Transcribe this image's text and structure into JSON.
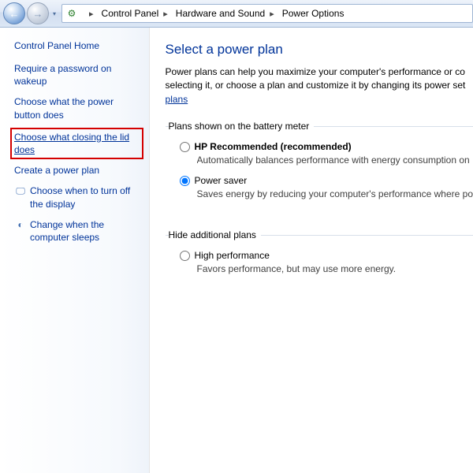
{
  "breadcrumb": {
    "root_chevron": "▸",
    "items": [
      {
        "label": "Control Panel"
      },
      {
        "label": "Hardware and Sound"
      },
      {
        "label": "Power Options"
      }
    ]
  },
  "sidebar": {
    "home": "Control Panel Home",
    "tasks": [
      {
        "label": "Require a password on wakeup",
        "icon": ""
      },
      {
        "label": "Choose what the power button does",
        "icon": ""
      },
      {
        "label": "Choose what closing the lid does",
        "icon": "",
        "highlight": true
      },
      {
        "label": "Create a power plan",
        "icon": ""
      },
      {
        "label": "Choose when to turn off the display",
        "icon": "🖵"
      },
      {
        "label": "Change when the computer sleeps",
        "icon": "◐"
      }
    ]
  },
  "main": {
    "title": "Select a power plan",
    "intro_a": "Power plans can help you maximize your computer's performance or co",
    "intro_b": "selecting it, or choose a plan and customize it by changing its power set",
    "intro_link": "plans",
    "group1_legend": "Plans shown on the battery meter",
    "group2_legend": "Hide additional plans",
    "plans_group1": [
      {
        "id": "plan-hp",
        "name_html": "HP Recommended (recommended)",
        "name_bold": true,
        "desc": "Automatically balances performance with energy consumption on",
        "selected": false
      },
      {
        "id": "plan-powersaver",
        "name_html": "Power saver",
        "name_bold": false,
        "desc": "Saves energy by reducing your computer's performance where po",
        "selected": true
      }
    ],
    "plans_group2": [
      {
        "id": "plan-highperf",
        "name_html": "High performance",
        "name_bold": false,
        "desc": "Favors performance, but may use more energy.",
        "selected": false
      }
    ]
  }
}
